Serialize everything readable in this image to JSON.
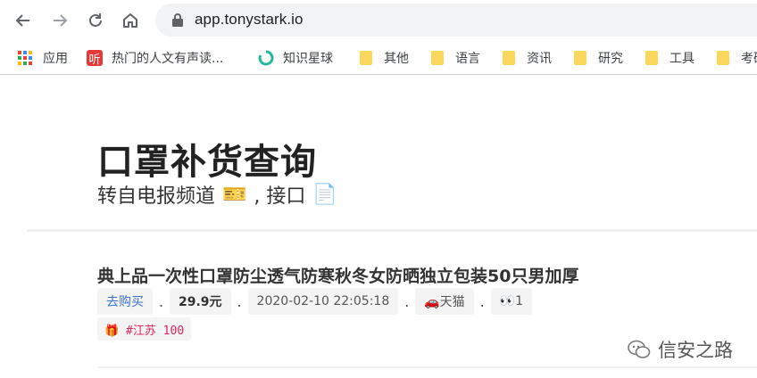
{
  "browser": {
    "url": "app.tonystark.io",
    "bookmarks": [
      {
        "label": "应用",
        "icon": "apps-grid-icon"
      },
      {
        "label": "热门的人文有声读...",
        "icon": "red-ting-icon"
      },
      {
        "label": "知识星球",
        "icon": "green-ring-icon"
      },
      {
        "label": "其他",
        "icon": "folder-icon"
      },
      {
        "label": "语言",
        "icon": "folder-icon"
      },
      {
        "label": "资讯",
        "icon": "folder-icon"
      },
      {
        "label": "研究",
        "icon": "folder-icon"
      },
      {
        "label": "工具",
        "icon": "folder-icon"
      },
      {
        "label": "考研",
        "icon": "folder-icon"
      }
    ],
    "ting_glyph": "听"
  },
  "page": {
    "title": "口罩补货查询",
    "subtitle_text": "转自电报频道",
    "subtitle_sep": ", 接口",
    "subtitle_emoji_1": "🎫",
    "subtitle_emoji_2": "📄"
  },
  "item": {
    "title": "典上品一次性口罩防尘透气防寒秋冬女防晒独立包装50只男加厚",
    "buy_label": "去购买",
    "price": "29.9元",
    "datetime": "2020-02-10 22:05:18",
    "store": "🚗天猫",
    "views": "👀1",
    "tag": "🎁 #江苏 100",
    "separator": "."
  },
  "watermark": {
    "text": "信安之路"
  },
  "colors": {
    "link": "#3b73c8",
    "tag": "#e0245e",
    "folder": "#fbd85b",
    "ring": "#2ab7a0",
    "ting": "#e53935"
  }
}
